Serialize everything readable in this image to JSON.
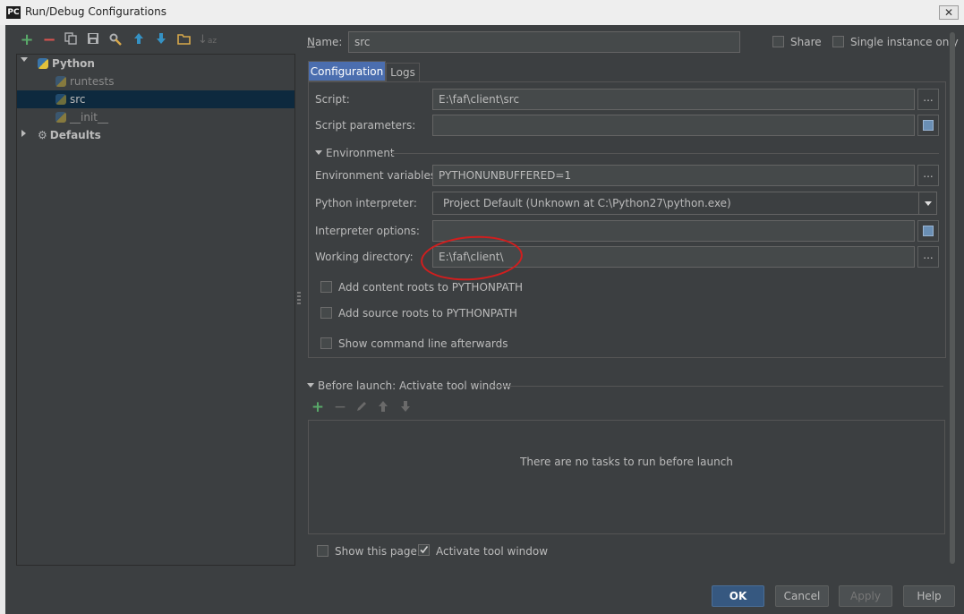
{
  "window": {
    "title": "Run/Debug Configurations",
    "app_icon": "PC",
    "close_glyph": "✕"
  },
  "toolbar": {
    "icons": [
      {
        "name": "add-icon",
        "glyph": "+",
        "color": "#59a869"
      },
      {
        "name": "remove-icon",
        "glyph": "−",
        "color": "#d9534f"
      },
      {
        "name": "copy-icon",
        "glyph": "⧉",
        "color": "#afb1b3"
      },
      {
        "name": "save-icon",
        "glyph": "▣",
        "color": "#afb1b3"
      },
      {
        "name": "wrench-icon",
        "glyph": "⚙",
        "color": "#afb1b3"
      },
      {
        "name": "arrow-up-icon",
        "glyph": "↑",
        "color": "#3592c4"
      },
      {
        "name": "arrow-down-icon",
        "glyph": "↓",
        "color": "#3592c4"
      },
      {
        "name": "folder-icon",
        "glyph": "▭",
        "color": "#d7a84b"
      },
      {
        "name": "sort-icon",
        "glyph": "⇅",
        "color": "#777777"
      }
    ]
  },
  "tree": {
    "python": "Python",
    "items": [
      "runtests",
      "src",
      "__init__"
    ],
    "defaults": "Defaults"
  },
  "form": {
    "name_label": "Name:",
    "name_value": "src",
    "share_label": "Share",
    "single_instance_label": "Single instance only",
    "tabs": [
      "Configuration",
      "Logs"
    ],
    "script_label": "Script:",
    "script_value": "E:\\faf\\client\\src",
    "script_params_label": "Script parameters:",
    "script_params_value": "",
    "environment_section": "Environment",
    "env_vars_label": "Environment variables:",
    "env_vars_value": "PYTHONUNBUFFERED=1",
    "interpreter_label": "Python interpreter:",
    "interpreter_value": "Project Default (Unknown at C:\\Python27\\python.exe)",
    "interp_options_label": "Interpreter options:",
    "interp_options_value": "",
    "workdir_label": "Working directory:",
    "workdir_value": "E:\\faf\\client\\",
    "add_content_roots": "Add content roots to PYTHONPATH",
    "add_source_roots": "Add source roots to PYTHONPATH",
    "show_cmdline": "Show command line afterwards",
    "dots": "..."
  },
  "before_launch": {
    "title": "Before launch: Activate tool window",
    "empty_text": "There are no tasks to run before launch",
    "show_page": "Show this page",
    "activate_tool_window": "Activate tool window"
  },
  "buttons": {
    "ok": "OK",
    "cancel": "Cancel",
    "apply": "Apply",
    "help": "Help"
  },
  "colors": {
    "accent": "#4b6eaf",
    "selection": "#0d293e",
    "annotation": "#d11e1e",
    "green": "#59a869"
  }
}
